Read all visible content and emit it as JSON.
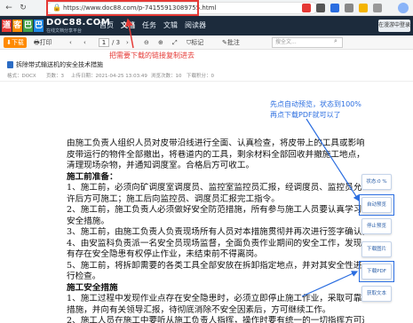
{
  "browser": {
    "back": "←",
    "refresh": "↻",
    "lock": "🔒",
    "url": "https://www.doc88.com/p-74155913089755.html"
  },
  "site": {
    "logo_chars": [
      "道",
      "客",
      "巴",
      "巴"
    ],
    "logo_colors": [
      "#e53935",
      "#fb8c00",
      "#43a047",
      "#1e88e5"
    ],
    "logo_text": "DOC88.COM",
    "logo_sub": "在线文档分享平台",
    "nav": [
      "首页",
      "文档",
      "任务",
      "文辑",
      "阅读器"
    ],
    "login": "在漫游中登录"
  },
  "toolbar": {
    "download": "下载",
    "print": "打印",
    "page_current": "1",
    "page_total": "/ 3",
    "zoom_out": "⊖",
    "zoom_in": "⊕",
    "fit": "⤢",
    "bookmark": "标记",
    "comment": "批注",
    "search_placeholder": "搜全文..."
  },
  "tip_top": "把需要下载的链接复制进去",
  "doc": {
    "title": "拆除带式输送机的安全技术措施",
    "meta": [
      "格式：DOCX",
      "页数：3",
      "上传日期：2021-04-25 13:03:49",
      "浏览次数：10",
      "下载积分：0"
    ]
  },
  "annotation_right": [
    "先点自动预览，状态到100%",
    "再点下载PDF就可以了"
  ],
  "body_lines": [
    {
      "text": "由施工负责人组织人员对皮带沿线进行全面、认真检查，将皮带上的工具或影响",
      "bold": false
    },
    {
      "text": "皮带运行的物件全部撤出，将巷道内的工具，剩余材料全部回收并撤施工地点，",
      "bold": false
    },
    {
      "text": "清理现场杂物，并通知调度室。合格后方可收工。",
      "bold": false
    },
    {
      "text": "施工前准备：",
      "bold": true
    },
    {
      "text": "1、施工前，必须向矿调度室调度员、监控室监控员汇报，经调度员、监控员允",
      "bold": false
    },
    {
      "text": "许后方可施工；施工后向监控员、调度员汇报完工指令。",
      "bold": false
    },
    {
      "text": "2、施工前，施工负责人必须做好安全防范措施，所有参与施工人员要认真学习",
      "bold": false
    },
    {
      "text": "安全措施。",
      "bold": false
    },
    {
      "text": "3、施工前，由施工负责人负责现场所有人员对本措施贯彻并再次进行签字确认。",
      "bold": false
    },
    {
      "text": "4、由安监科负责派一名安全员现场监督，全面负责作业期间的安全工作，发现",
      "bold": false
    },
    {
      "text": "有存在安全隐患有权停止作业，未结束前不得离岗。",
      "bold": false
    },
    {
      "text": "5、施工前，将拆卸需要的各类工具全部安放在拆卸指定地点，并对其安全性进",
      "bold": false
    },
    {
      "text": "行检查。",
      "bold": false
    },
    {
      "text": "施工安全措施",
      "bold": true
    },
    {
      "text": "1、施工过程中发现作业点存在安全隐患时，必须立即停止施工作业，采取可靠",
      "bold": false
    },
    {
      "text": "措施，并向有关领导汇报，待彻底消除不安全因素后，方可继续工作。",
      "bold": false
    },
    {
      "text": "2、施工人员在施工中要听从施工负责人指挥，操作时要有统一的一切指挥方可进",
      "bold": false
    }
  ],
  "side_buttons": [
    "状态:0 %",
    "自动预览",
    "停止预览",
    "下载图片",
    "下载PDF",
    "获取文本"
  ]
}
